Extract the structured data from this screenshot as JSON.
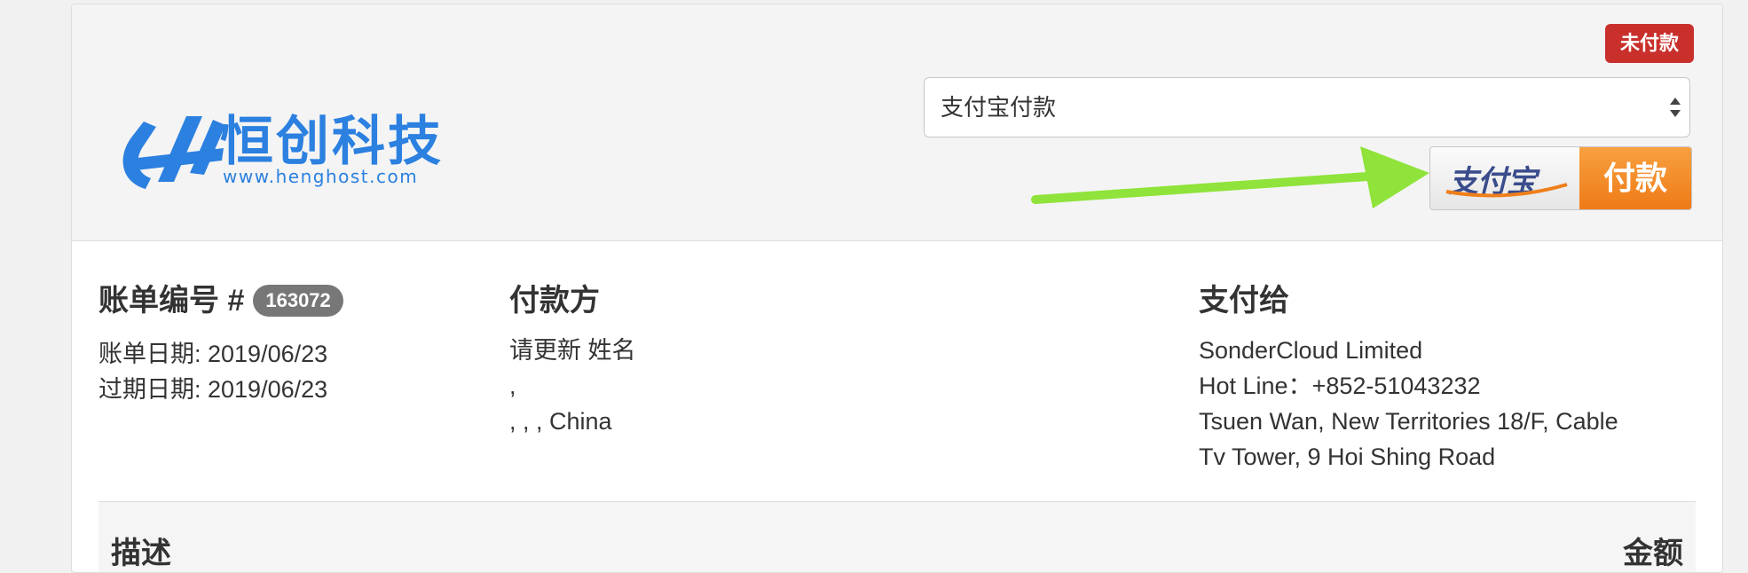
{
  "logo": {
    "name": "恒创科技",
    "url": "www.henghost.com",
    "color": "#2b80e0"
  },
  "status": {
    "label": "未付款",
    "color": "#c9302c"
  },
  "payment": {
    "method_selected": "支付宝付款",
    "button_logo": "支付宝",
    "button_label": "付款"
  },
  "invoice": {
    "title": "账单编号 #",
    "number": "163072",
    "date_line": "账单日期: 2019/06/23",
    "due_line": "过期日期: 2019/06/23"
  },
  "payer": {
    "title": "付款方",
    "lines": [
      "请更新 姓名",
      ",",
      ", , , China"
    ]
  },
  "pay_to": {
    "title": "支付给",
    "lines": [
      "SonderCloud Limited",
      "Hot Line：+852-51043232",
      "Tsuen Wan, New Territories 18/F, Cable",
      "Tv Tower, 9 Hoi Shing Road"
    ]
  },
  "table": {
    "col_description": "描述",
    "col_amount": "金额"
  },
  "colors": {
    "arrow": "#8fe33a",
    "pay_orange": "#ef7f1a"
  },
  "icons": {
    "logo_mark": "henghost-logo-icon",
    "select_arrows": "select-updown-icon",
    "pointer": "green-arrow-icon"
  }
}
